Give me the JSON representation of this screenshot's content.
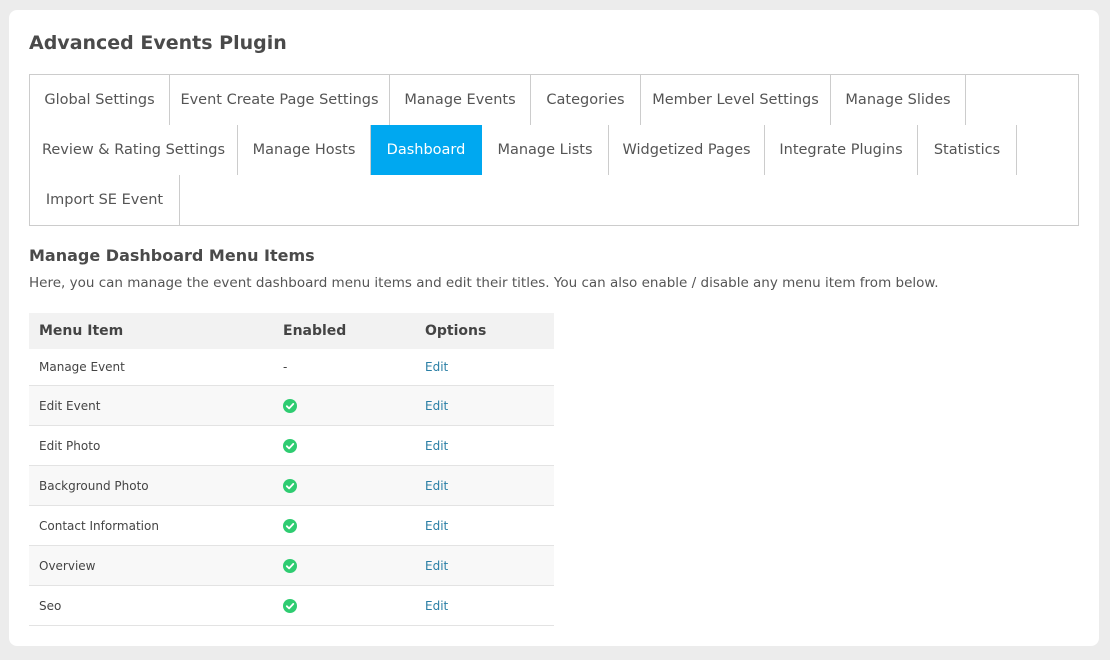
{
  "page": {
    "title": "Advanced Events Plugin"
  },
  "tabs": [
    {
      "label": "Global Settings",
      "active": false
    },
    {
      "label": "Event Create Page Settings",
      "active": false
    },
    {
      "label": "Manage Events",
      "active": false
    },
    {
      "label": "Categories",
      "active": false
    },
    {
      "label": "Member Level Settings",
      "active": false
    },
    {
      "label": "Manage Slides",
      "active": false
    },
    {
      "label": "Review & Rating Settings",
      "active": false
    },
    {
      "label": "Manage Hosts",
      "active": false
    },
    {
      "label": "Dashboard",
      "active": true
    },
    {
      "label": "Manage Lists",
      "active": false
    },
    {
      "label": "Widgetized Pages",
      "active": false
    },
    {
      "label": "Integrate Plugins",
      "active": false
    },
    {
      "label": "Statistics",
      "active": false
    },
    {
      "label": "Import SE Event",
      "active": false
    }
  ],
  "section": {
    "title": "Manage Dashboard Menu Items",
    "description": "Here, you can manage the event dashboard menu items and edit their titles. You can also enable / disable any menu item from below."
  },
  "table": {
    "headers": [
      "Menu Item",
      "Enabled",
      "Options"
    ],
    "rows": [
      {
        "item": "Manage Event",
        "enabled_text": "-",
        "enabled": null,
        "option": "Edit"
      },
      {
        "item": "Edit Event",
        "enabled_text": "",
        "enabled": true,
        "option": "Edit"
      },
      {
        "item": "Edit Photo",
        "enabled_text": "",
        "enabled": true,
        "option": "Edit"
      },
      {
        "item": "Background Photo",
        "enabled_text": "",
        "enabled": true,
        "option": "Edit"
      },
      {
        "item": "Contact Information",
        "enabled_text": "",
        "enabled": true,
        "option": "Edit"
      },
      {
        "item": "Overview",
        "enabled_text": "",
        "enabled": true,
        "option": "Edit"
      },
      {
        "item": "Seo",
        "enabled_text": "",
        "enabled": true,
        "option": "Edit"
      }
    ]
  },
  "icons": {
    "enabled": "check-circle-icon"
  },
  "colors": {
    "active_tab": "#00a8f0",
    "link": "#2a7fa5",
    "check": "#2ecc71"
  }
}
